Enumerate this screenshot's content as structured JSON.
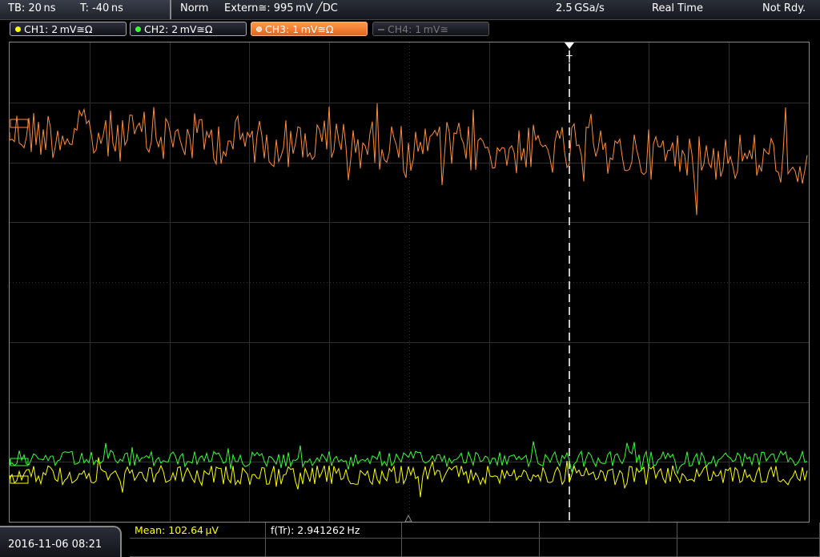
{
  "header": {
    "timebase": "TB: 20 ns",
    "trigger_time": "T: -40 ns",
    "acq_mode": "Norm",
    "trigger_source": "Extern≅: 995 mV ╱DC",
    "sample_rate": "2.5 GSa/s",
    "realtime": "Real Time",
    "status": "Not Rdy."
  },
  "channels": [
    {
      "label": "CH1: 2 mV≅Ω",
      "color": "#ffff00",
      "state": "on"
    },
    {
      "label": "CH2: 2 mV≅Ω",
      "color": "#33ff33",
      "state": "on"
    },
    {
      "label": "CH3: 1 mV≅Ω",
      "color": "#ff8c3a",
      "state": "selected"
    },
    {
      "label": "CH4: 1 mV≅",
      "color": "#666666",
      "state": "off"
    }
  ],
  "trigger_marker": "T",
  "measurements": {
    "mean": "Mean: 102.64 µV",
    "freq": "f(Tr): 2.941262 Hz"
  },
  "datetime": "2016-11-06 08:21",
  "colors": {
    "ch1": "#ffff00",
    "ch2": "#33ff33",
    "ch3": "#ff8c3a",
    "grid": "#2e2e2e",
    "measure_text": "#ffff00"
  }
}
